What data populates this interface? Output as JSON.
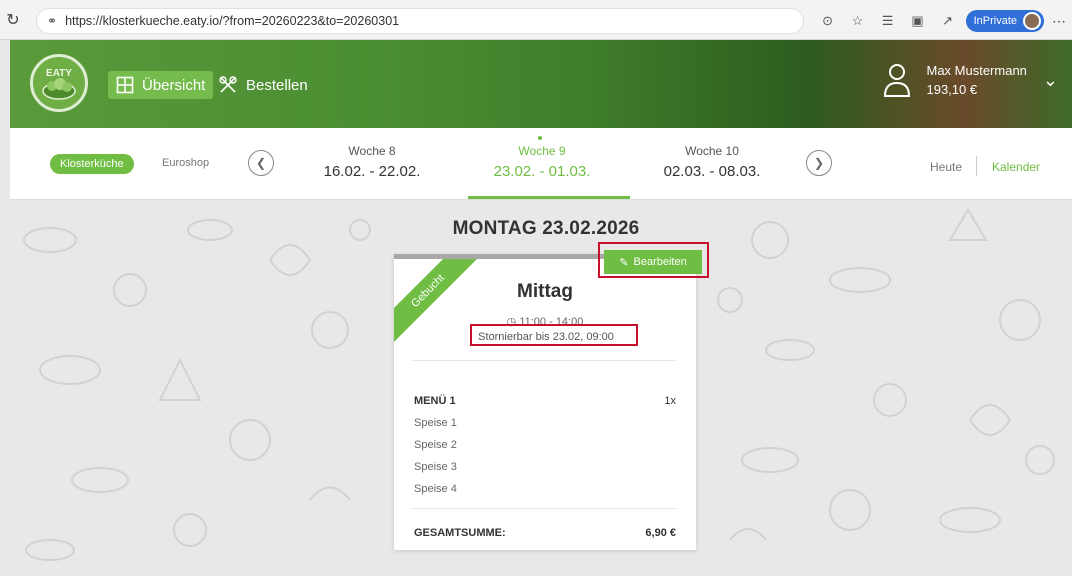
{
  "browser": {
    "url": "https://klosterkueche.eaty.io/?from=20260223&to=20260301",
    "inprivate_label": "InPrivate"
  },
  "header": {
    "logo_text": "EATY",
    "nav": [
      {
        "label": "Übersicht",
        "icon": "grid-icon",
        "active": true
      },
      {
        "label": "Bestellen",
        "icon": "cutlery-icon",
        "active": false
      }
    ],
    "user": {
      "name": "Max Mustermann",
      "balance": "193,10 €"
    }
  },
  "week_nav": {
    "shops": [
      {
        "label": "Klosterküche",
        "active": true
      },
      {
        "label": "Euroshop",
        "active": false
      }
    ],
    "weeks": [
      {
        "label": "Woche 8",
        "dates": "16.02. - 22.02.",
        "active": false
      },
      {
        "label": "Woche 9",
        "dates": "23.02. - 01.03.",
        "active": true
      },
      {
        "label": "Woche 10",
        "dates": "02.03. - 08.03.",
        "active": false
      }
    ],
    "today_label": "Heute",
    "calendar_label": "Kalender"
  },
  "day": {
    "title": "MONTAG 23.02.2026",
    "card": {
      "ribbon": "Gebucht",
      "edit_label": "Bearbeiten",
      "meal": "Mittag",
      "time": "11:00 - 14:00",
      "storno": "Stornierbar bis 23.02, 09:00",
      "menu_name": "MENÜ 1",
      "quantity": "1x",
      "dishes": [
        "Speise 1",
        "Speise 2",
        "Speise 3",
        "Speise 4"
      ],
      "total_label": "GESAMTSUMME:",
      "total_value": "6,90 €"
    }
  },
  "colors": {
    "accent_green": "#6fbe43",
    "highlight_red": "#c8102e"
  }
}
